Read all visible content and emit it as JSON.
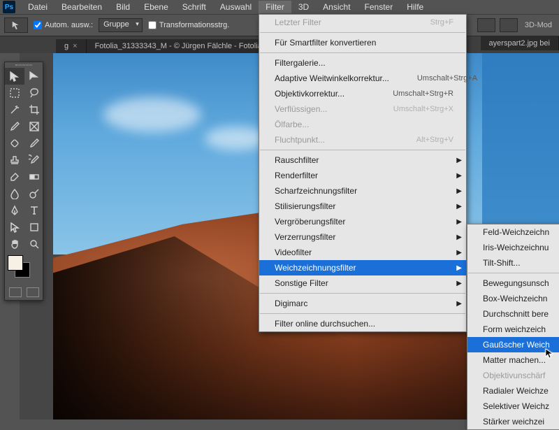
{
  "app": {
    "logo": "Ps"
  },
  "menubar": [
    "Datei",
    "Bearbeiten",
    "Bild",
    "Ebene",
    "Schrift",
    "Auswahl",
    "Filter",
    "3D",
    "Ansicht",
    "Fenster",
    "Hilfe"
  ],
  "options": {
    "auto_select": "Autom. ausw.:",
    "group": "Gruppe",
    "transform": "Transformationsstrg.",
    "mode": "3D-Mod"
  },
  "tabs": {
    "left_suffix": "g",
    "center": "Fotolia_31333343_M - © Jürgen Fälchle - Fotolia",
    "right": "ayerspart2.jpg bei"
  },
  "filter_menu": {
    "last": {
      "label": "Letzter Filter",
      "shortcut": "Strg+F"
    },
    "smart": {
      "label": "Für Smartfilter konvertieren"
    },
    "gallery": {
      "label": "Filtergalerie..."
    },
    "wide": {
      "label": "Adaptive Weitwinkelkorrektur...",
      "shortcut": "Umschalt+Strg+A"
    },
    "lens": {
      "label": "Objektivkorrektur...",
      "shortcut": "Umschalt+Strg+R"
    },
    "liquify": {
      "label": "Verflüssigen...",
      "shortcut": "Umschalt+Strg+X"
    },
    "oil": {
      "label": "Ölfarbe..."
    },
    "vanish": {
      "label": "Fluchtpunkt...",
      "shortcut": "Alt+Strg+V"
    },
    "noise": {
      "label": "Rauschfilter"
    },
    "render": {
      "label": "Renderfilter"
    },
    "sharpen": {
      "label": "Scharfzeichnungsfilter"
    },
    "stylize": {
      "label": "Stilisierungsfilter"
    },
    "pixelate": {
      "label": "Vergröberungsfilter"
    },
    "distort": {
      "label": "Verzerrungsfilter"
    },
    "video": {
      "label": "Videofilter"
    },
    "blur": {
      "label": "Weichzeichnungsfilter"
    },
    "other": {
      "label": "Sonstige Filter"
    },
    "digimarc": {
      "label": "Digimarc"
    },
    "online": {
      "label": "Filter online durchsuchen..."
    }
  },
  "blur_submenu": {
    "field": "Feld-Weichzeichn",
    "iris": "Iris-Weichzeichnu",
    "tilt": "Tilt-Shift...",
    "motion": "Bewegungsunsch",
    "box": "Box-Weichzeichn",
    "average": "Durchschnitt bere",
    "shape": "Form weichzeich",
    "gaussian": "Gaußscher Weich",
    "smart": "Matter machen...",
    "lens": "Objektivunschärf",
    "radial": "Radialer Weichze",
    "selective": "Selektiver Weichz",
    "surface": "Stärker weichzei"
  },
  "tools": {
    "names": [
      "move",
      "artboard",
      "marquee",
      "lasso",
      "wand",
      "crop",
      "eyedropper",
      "frame",
      "heal",
      "brush",
      "stamp",
      "history",
      "eraser",
      "gradient",
      "blur",
      "dodge",
      "pen",
      "type",
      "path",
      "shape",
      "hand",
      "zoom"
    ]
  }
}
